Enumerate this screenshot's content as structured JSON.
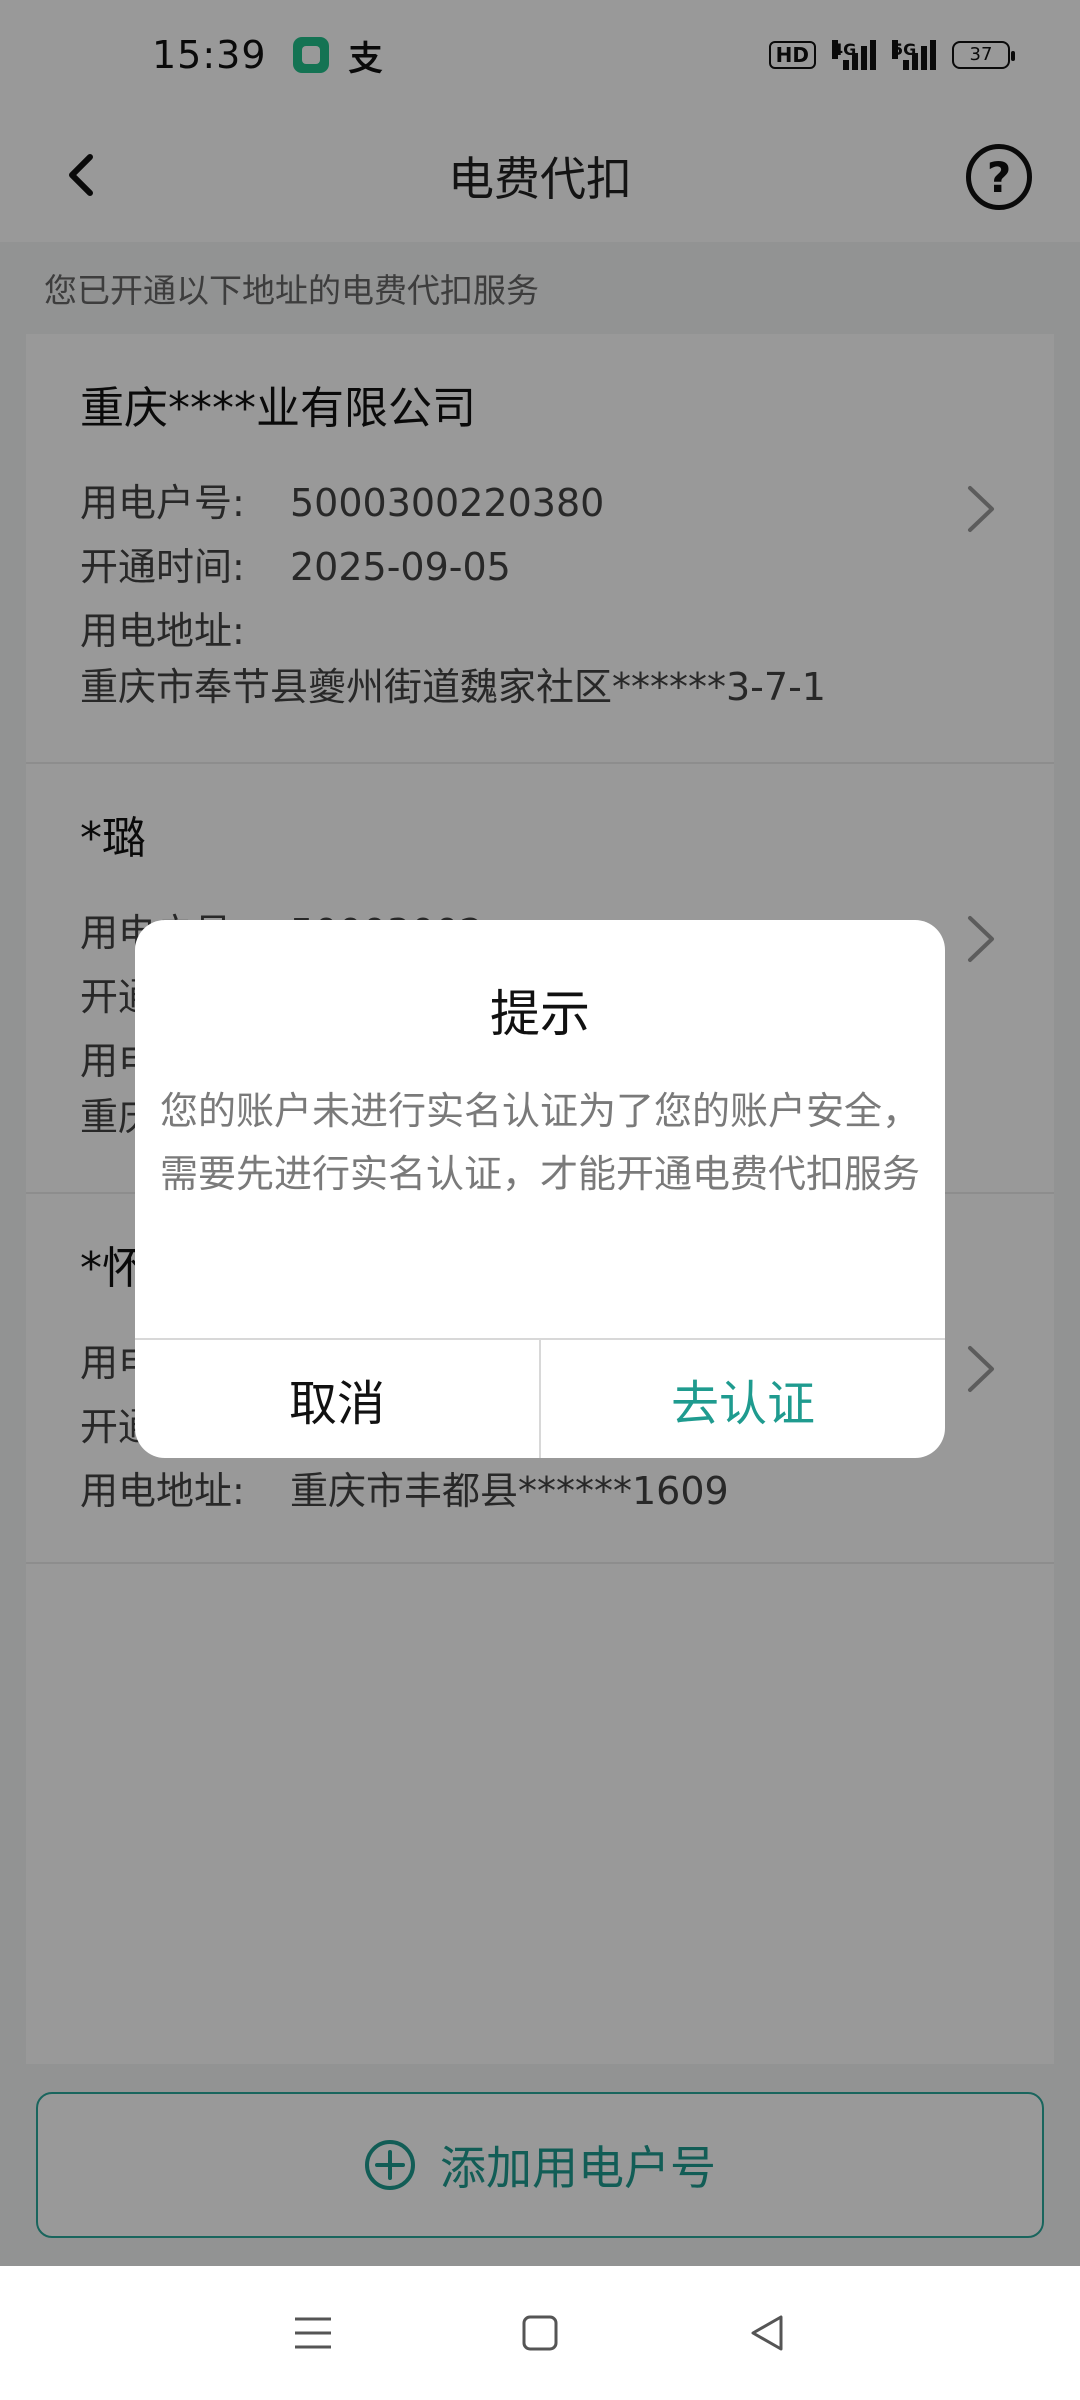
{
  "status_bar": {
    "time": "15:39",
    "alipay_glyph": "支",
    "hd": "HD",
    "network_1": "4G",
    "network_2": "5G",
    "battery": "37"
  },
  "header": {
    "title": "电费代扣",
    "help_glyph": "?"
  },
  "section_hint": "您已开通以下地址的电费代扣服务",
  "accounts": [
    {
      "name": "重庆****业有限公司",
      "account_label": "用电户号:",
      "account_number": "5000300220380",
      "date_label": "开通时间:",
      "date": "2025-09-05",
      "address_label": "用电地址:",
      "address": "重庆市奉节县夔州街道魏家社区******3-7-1"
    },
    {
      "name": "*璐",
      "account_label": "用电户号:",
      "account_number": "50003002",
      "date_label": "开通时间:",
      "address_label": "用电地址:",
      "address": "重庆"
    },
    {
      "name": "*怀",
      "account_label": "用电户号:",
      "date_label": "开通时间:",
      "address_label": "用电地址:",
      "address": "重庆市丰都县******1609"
    }
  ],
  "add_button_label": "添加用电户号",
  "dialog": {
    "title": "提示",
    "message": "您的账户未进行实名认证为了您的账户安全，需要先进行实名认证，才能开通电费代扣服务",
    "cancel": "取消",
    "confirm": "去认证"
  },
  "colors": {
    "accent": "#1f9b8f",
    "overlay": "rgba(0,0,0,0.40)"
  },
  "icons": {
    "back": "chevron-left-icon",
    "help": "question-circle-icon",
    "row": "chevron-right-icon",
    "add": "plus-circle-icon",
    "menu": "menu-icon",
    "home": "square-icon",
    "back_nav": "triangle-back-icon"
  }
}
